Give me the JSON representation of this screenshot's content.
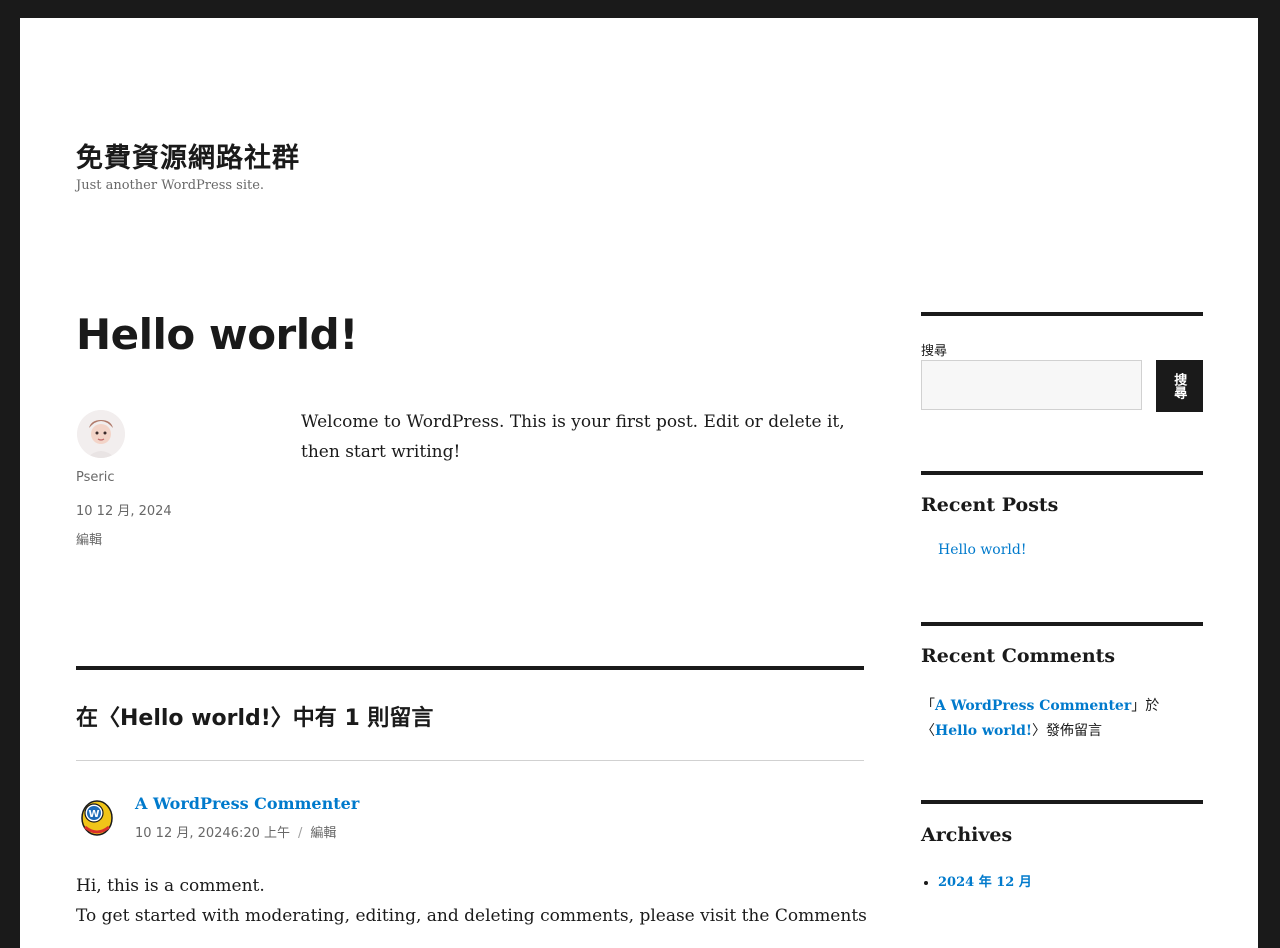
{
  "site": {
    "title": "免費資源網路社群",
    "description": "Just another WordPress site."
  },
  "post": {
    "title": "Hello world!",
    "author": "Pseric",
    "date": "10 12 月, 2024",
    "edit_label": "編輯",
    "content": "Welcome to WordPress. This is your first post. Edit or delete it, then start writing!"
  },
  "comments": {
    "heading": "在〈Hello world!〉中有 1 則留言",
    "items": [
      {
        "author": "A WordPress Commenter",
        "datetime": "10 12 月, 20246:20 上午",
        "separator": "/",
        "edit_label": "編輯",
        "body_line1": "Hi, this is a comment.",
        "body_line2": "To get started with moderating, editing, and deleting comments, please visit the Comments"
      }
    ]
  },
  "sidebar": {
    "search": {
      "label": "搜尋",
      "button_label": "搜尋"
    },
    "recent_posts": {
      "title": "Recent Posts",
      "items": [
        "Hello world!"
      ]
    },
    "recent_comments": {
      "title": "Recent Comments",
      "open_quote": "「",
      "author": "A WordPress Commenter",
      "mid": "」於〈",
      "post": "Hello world!",
      "tail": "〉發佈留言"
    },
    "archives": {
      "title": "Archives",
      "items": [
        "2024 年 12 月"
      ]
    }
  },
  "colors": {
    "accent": "#007acc",
    "text": "#1a1a1a",
    "muted": "#686868",
    "frame": "#1a1a1a"
  }
}
